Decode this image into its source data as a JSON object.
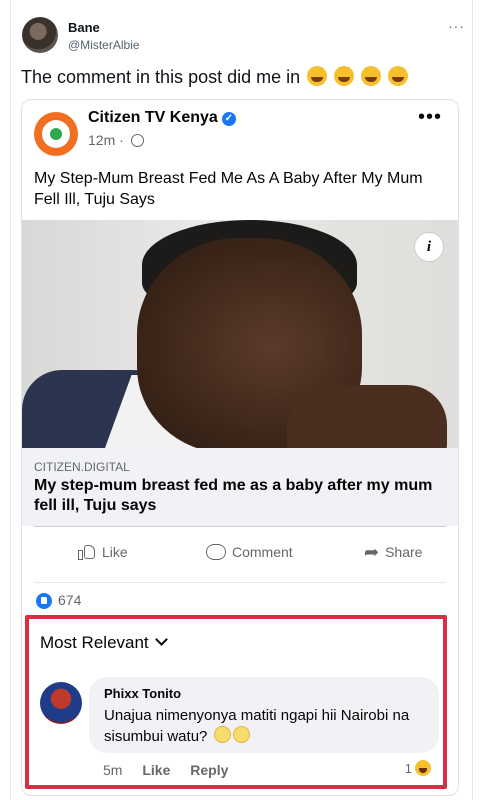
{
  "tweet": {
    "author_name": "Bane",
    "author_handle": "@MisterAlbie",
    "more_icon": "more-horizontal-icon",
    "text": "The comment in this post did me in",
    "emoji": [
      "face-with-tears-of-joy",
      "face-with-tears-of-joy",
      "face-with-tears-of-joy",
      "face-with-tears-of-joy"
    ]
  },
  "fb_post": {
    "page_name": "Citizen TV Kenya",
    "verified_icon": "verified-badge-icon",
    "time": "12m",
    "separator": "·",
    "privacy_icon": "globe-icon",
    "more_label": "•••",
    "title": "My Step-Mum Breast Fed Me As A Baby After My Mum Fell Ill, Tuju Says",
    "info_label": "i",
    "link_domain": "CITIZEN.DIGITAL",
    "link_title": "My step-mum breast fed me as a baby after my mum fell ill, Tuju says",
    "actions": {
      "like": "Like",
      "comment": "Comment",
      "share": "Share"
    },
    "reaction_count": "674"
  },
  "comments": {
    "sort_label": "Most Relevant",
    "highlight_color": "#d92d45",
    "items": [
      {
        "author": "Phixx Tonito",
        "text": "Unajua nimenyonya matiti ngapi hii Nairobi na sisumbui watu?",
        "emoji": [
          "unamused-face",
          "unamused-face"
        ],
        "time": "5m",
        "like_label": "Like",
        "reply_label": "Reply",
        "reaction_count": "1"
      }
    ]
  },
  "colors": {
    "facebook_blue": "#1877f2",
    "citizen_orange": "#f26f21",
    "text_secondary": "#65676b"
  }
}
